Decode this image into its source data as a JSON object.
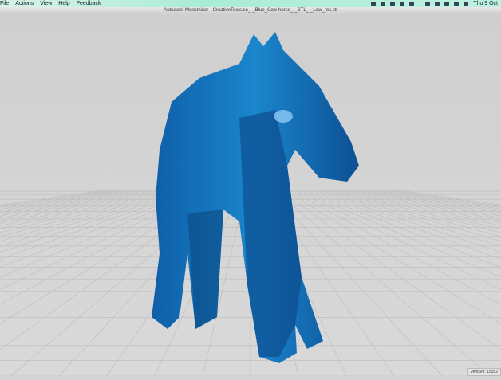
{
  "menubar": {
    "items": [
      "File",
      "Actions",
      "View",
      "Help",
      "Feedback"
    ],
    "clock": "Thu 9 Oct",
    "status_icons": [
      "screen-icon",
      "sync-icon",
      "window-icon",
      "bell-icon",
      "airplay-icon",
      "display-icon",
      "clock-icon",
      "wifi-icon",
      "volume-icon",
      "battery-icon"
    ]
  },
  "window": {
    "title": "Autodesk Meshmixer - CreativeTools.se_-_Blue_Cow-horse_-_STL_-_Low_res.stl"
  },
  "viewport": {
    "model_color": "#1a7fc4",
    "status": "vertices: 15052"
  }
}
